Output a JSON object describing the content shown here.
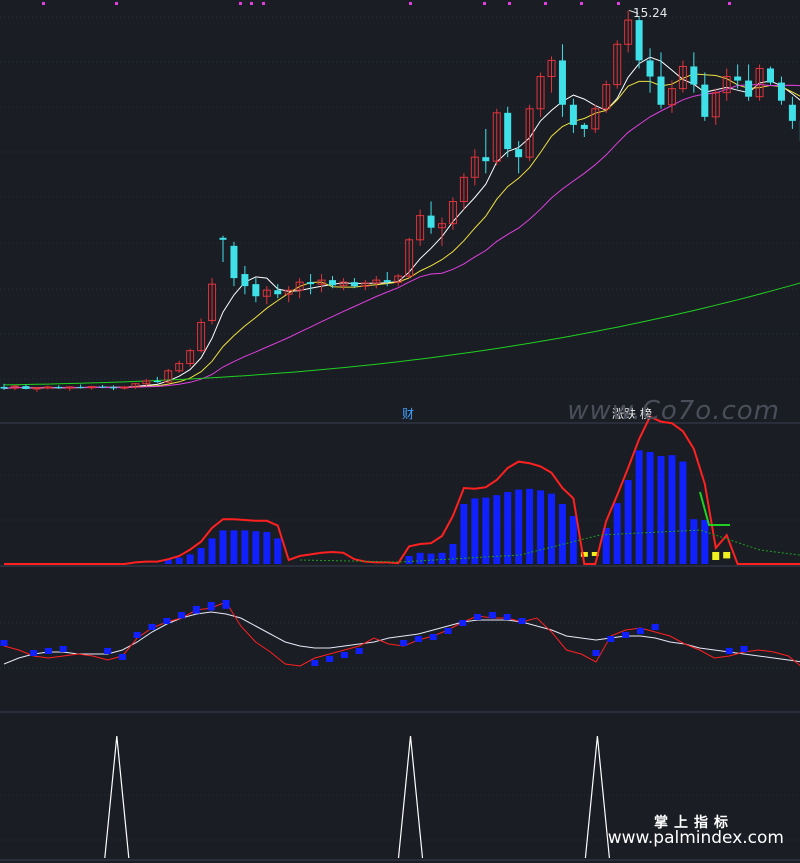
{
  "labels": {
    "price_high": "15.24",
    "tag_cai": "财",
    "tag_rank": "涨跌 榜",
    "watermark_top": "www.Co7o.com",
    "watermark_brand": "掌上指标",
    "watermark_url": "www.palmindex.com"
  },
  "colors": {
    "background": "#1a1d24",
    "up": "#e0343a",
    "down": "#40e0e8",
    "ma5": "#ffffff",
    "ma10": "#f0e040",
    "ma20": "#e040e0",
    "ma60": "#20d020",
    "histogram": "#1020ff",
    "highlight": "#f0f020",
    "envelope": "#ff2020",
    "signal": "#ffffff"
  },
  "chart_data": [
    {
      "type": "candlestick",
      "y_high_label": 15.24,
      "candles": [
        {
          "o": 5.9,
          "h": 5.98,
          "l": 5.83,
          "c": 5.86
        },
        {
          "o": 5.87,
          "h": 5.95,
          "l": 5.82,
          "c": 5.92
        },
        {
          "o": 5.92,
          "h": 5.96,
          "l": 5.84,
          "c": 5.85
        },
        {
          "o": 5.85,
          "h": 5.9,
          "l": 5.78,
          "c": 5.88
        },
        {
          "o": 5.88,
          "h": 5.93,
          "l": 5.84,
          "c": 5.9
        },
        {
          "o": 5.9,
          "h": 5.94,
          "l": 5.85,
          "c": 5.87
        },
        {
          "o": 5.87,
          "h": 5.92,
          "l": 5.8,
          "c": 5.9
        },
        {
          "o": 5.9,
          "h": 5.96,
          "l": 5.86,
          "c": 5.88
        },
        {
          "o": 5.88,
          "h": 5.93,
          "l": 5.83,
          "c": 5.91
        },
        {
          "o": 5.91,
          "h": 5.95,
          "l": 5.87,
          "c": 5.89
        },
        {
          "o": 5.89,
          "h": 5.94,
          "l": 5.82,
          "c": 5.87
        },
        {
          "o": 5.87,
          "h": 5.92,
          "l": 5.83,
          "c": 5.9
        },
        {
          "o": 5.9,
          "h": 6.0,
          "l": 5.85,
          "c": 5.98
        },
        {
          "o": 5.98,
          "h": 6.1,
          "l": 5.92,
          "c": 6.05
        },
        {
          "o": 6.05,
          "h": 6.15,
          "l": 6.0,
          "c": 6.02
        },
        {
          "o": 6.02,
          "h": 6.35,
          "l": 6.0,
          "c": 6.3
        },
        {
          "o": 6.3,
          "h": 6.55,
          "l": 6.25,
          "c": 6.48
        },
        {
          "o": 6.48,
          "h": 6.85,
          "l": 6.4,
          "c": 6.8
        },
        {
          "o": 6.8,
          "h": 7.6,
          "l": 6.75,
          "c": 7.5
        },
        {
          "o": 7.55,
          "h": 8.6,
          "l": 7.45,
          "c": 8.45
        },
        {
          "o": 9.6,
          "h": 9.65,
          "l": 9.0,
          "c": 9.55
        },
        {
          "o": 9.4,
          "h": 9.5,
          "l": 8.4,
          "c": 8.6
        },
        {
          "o": 8.7,
          "h": 8.9,
          "l": 8.2,
          "c": 8.4
        },
        {
          "o": 8.45,
          "h": 8.6,
          "l": 8.0,
          "c": 8.15
        },
        {
          "o": 8.15,
          "h": 8.4,
          "l": 7.95,
          "c": 8.3
        },
        {
          "o": 8.3,
          "h": 8.45,
          "l": 8.1,
          "c": 8.2
        },
        {
          "o": 8.2,
          "h": 8.4,
          "l": 8.0,
          "c": 8.3
        },
        {
          "o": 8.3,
          "h": 8.6,
          "l": 8.1,
          "c": 8.5
        },
        {
          "o": 8.5,
          "h": 8.7,
          "l": 8.2,
          "c": 8.45
        },
        {
          "o": 8.45,
          "h": 8.7,
          "l": 8.25,
          "c": 8.55
        },
        {
          "o": 8.55,
          "h": 8.65,
          "l": 8.35,
          "c": 8.42
        },
        {
          "o": 8.42,
          "h": 8.6,
          "l": 8.3,
          "c": 8.5
        },
        {
          "o": 8.5,
          "h": 8.6,
          "l": 8.35,
          "c": 8.4
        },
        {
          "o": 8.4,
          "h": 8.55,
          "l": 8.3,
          "c": 8.48
        },
        {
          "o": 8.48,
          "h": 8.65,
          "l": 8.35,
          "c": 8.55
        },
        {
          "o": 8.55,
          "h": 8.75,
          "l": 8.4,
          "c": 8.5
        },
        {
          "o": 8.5,
          "h": 8.7,
          "l": 8.4,
          "c": 8.65
        },
        {
          "o": 8.65,
          "h": 9.6,
          "l": 8.6,
          "c": 9.55
        },
        {
          "o": 9.55,
          "h": 10.3,
          "l": 9.4,
          "c": 10.15
        },
        {
          "o": 10.15,
          "h": 10.5,
          "l": 9.7,
          "c": 9.85
        },
        {
          "o": 9.85,
          "h": 10.1,
          "l": 9.4,
          "c": 9.95
        },
        {
          "o": 9.95,
          "h": 10.6,
          "l": 9.8,
          "c": 10.5
        },
        {
          "o": 10.5,
          "h": 11.2,
          "l": 10.3,
          "c": 11.1
        },
        {
          "o": 11.1,
          "h": 11.8,
          "l": 10.9,
          "c": 11.6
        },
        {
          "o": 11.6,
          "h": 12.3,
          "l": 11.2,
          "c": 11.5
        },
        {
          "o": 11.5,
          "h": 12.8,
          "l": 11.4,
          "c": 12.7
        },
        {
          "o": 12.7,
          "h": 12.85,
          "l": 11.6,
          "c": 11.8
        },
        {
          "o": 11.8,
          "h": 12.0,
          "l": 11.2,
          "c": 11.6
        },
        {
          "o": 11.6,
          "h": 12.9,
          "l": 11.5,
          "c": 12.8
        },
        {
          "o": 12.8,
          "h": 13.7,
          "l": 12.6,
          "c": 13.6
        },
        {
          "o": 13.6,
          "h": 14.1,
          "l": 13.2,
          "c": 14.0
        },
        {
          "o": 14.0,
          "h": 14.4,
          "l": 12.6,
          "c": 12.9
        },
        {
          "o": 12.9,
          "h": 13.05,
          "l": 12.2,
          "c": 12.4
        },
        {
          "o": 12.4,
          "h": 12.45,
          "l": 12.1,
          "c": 12.3
        },
        {
          "o": 12.3,
          "h": 12.9,
          "l": 12.2,
          "c": 12.8
        },
        {
          "o": 12.8,
          "h": 13.5,
          "l": 12.7,
          "c": 13.4
        },
        {
          "o": 13.4,
          "h": 14.5,
          "l": 13.3,
          "c": 14.4
        },
        {
          "o": 14.4,
          "h": 15.24,
          "l": 14.2,
          "c": 15.0
        },
        {
          "o": 15.0,
          "h": 15.1,
          "l": 13.8,
          "c": 14.0
        },
        {
          "o": 14.0,
          "h": 14.3,
          "l": 13.2,
          "c": 13.6
        },
        {
          "o": 13.6,
          "h": 14.2,
          "l": 12.8,
          "c": 12.9
        },
        {
          "o": 12.9,
          "h": 13.5,
          "l": 12.7,
          "c": 13.3
        },
        {
          "o": 13.3,
          "h": 14.0,
          "l": 13.2,
          "c": 13.85
        },
        {
          "o": 13.85,
          "h": 14.2,
          "l": 13.2,
          "c": 13.4
        },
        {
          "o": 13.4,
          "h": 13.7,
          "l": 12.5,
          "c": 12.6
        },
        {
          "o": 12.6,
          "h": 13.3,
          "l": 12.4,
          "c": 13.2
        },
        {
          "o": 13.2,
          "h": 13.8,
          "l": 13.0,
          "c": 13.6
        },
        {
          "o": 13.6,
          "h": 13.9,
          "l": 13.3,
          "c": 13.5
        },
        {
          "o": 13.5,
          "h": 13.9,
          "l": 13.0,
          "c": 13.1
        },
        {
          "o": 13.1,
          "h": 13.9,
          "l": 13.0,
          "c": 13.8
        },
        {
          "o": 13.8,
          "h": 13.85,
          "l": 13.4,
          "c": 13.45
        },
        {
          "o": 13.45,
          "h": 13.6,
          "l": 12.9,
          "c": 13.0
        },
        {
          "o": 12.9,
          "h": 13.1,
          "l": 12.3,
          "c": 12.5
        },
        {
          "o": 12.5,
          "h": 12.6,
          "l": 11.9,
          "c": 12.0
        }
      ],
      "moving_averages": [
        {
          "period": 5,
          "color": "ma5"
        },
        {
          "period": 10,
          "color": "ma10"
        },
        {
          "period": 20,
          "color": "ma20"
        },
        {
          "period": 60,
          "color": "ma60"
        }
      ]
    },
    {
      "type": "bar",
      "histogram": [
        0,
        0,
        0,
        0,
        0,
        0,
        0,
        0,
        0,
        0,
        0,
        0,
        0,
        0,
        0,
        0.6,
        0.8,
        1.2,
        2.0,
        3.2,
        4.2,
        4.2,
        4.2,
        4.1,
        4.0,
        3.2,
        0,
        0,
        0,
        0,
        0,
        0,
        0,
        0,
        0,
        0,
        0,
        1.0,
        1.4,
        1.3,
        1.4,
        2.5,
        7.5,
        8.2,
        8.3,
        8.6,
        9.0,
        9.3,
        9.4,
        9.2,
        8.8,
        7.5,
        6.0,
        -0.6,
        -0.5,
        4.5,
        7.6,
        10.5,
        14.2,
        14.0,
        13.5,
        13.6,
        12.8,
        5.6,
        5.5,
        -1.0,
        -0.8,
        0,
        0,
        0,
        0,
        0,
        0,
        0
      ],
      "envelope": [
        0,
        0,
        0,
        0,
        0,
        0,
        0,
        0,
        0,
        0,
        0,
        0,
        0.2,
        0.3,
        0.3,
        0.6,
        1.0,
        1.8,
        2.8,
        4.5,
        5.6,
        5.6,
        5.5,
        5.4,
        5.4,
        4.8,
        0.5,
        1.0,
        1.2,
        1.4,
        1.5,
        1.4,
        0.6,
        0.3,
        0.2,
        0.2,
        0.1,
        2.2,
        2.5,
        2.6,
        3.5,
        6.0,
        9.5,
        9.4,
        9.6,
        10.5,
        12.0,
        12.8,
        12.6,
        12.2,
        11.4,
        9.5,
        8.2,
        0,
        0,
        5.4,
        8.6,
        12.0,
        15.6,
        18.4,
        17.8,
        17.6,
        16.6,
        14.4,
        10.0,
        2.0,
        3.6,
        -1.2,
        0,
        0,
        0,
        0,
        0,
        0
      ],
      "highlight_bars": [
        53,
        54,
        65,
        66,
        67
      ]
    },
    {
      "type": "line",
      "bars": [
        0.2,
        0,
        -0.3,
        -0.2,
        -0.1,
        0,
        0,
        -0.2,
        -0.5,
        0.6,
        1.0,
        1.3,
        1.6,
        1.9,
        2.1,
        2.2,
        0,
        0,
        0,
        0,
        0,
        -0.8,
        -0.6,
        -0.4,
        -0.2,
        0,
        0,
        0.2,
        0.4,
        0.5,
        0.8,
        1.2,
        1.5,
        1.6,
        1.5,
        1.3,
        0,
        0,
        0,
        0,
        -0.3,
        0.4,
        0.6,
        0.8,
        1.0,
        0,
        0,
        0,
        0,
        -0.2,
        -0.1,
        0,
        0
      ],
      "fast": [
        0.1,
        -0.1,
        -0.4,
        -0.5,
        -0.4,
        -0.3,
        -0.4,
        -0.6,
        -0.4,
        0.5,
        1.0,
        1.3,
        1.5,
        1.9,
        2.0,
        2.3,
        1.1,
        0.3,
        -0.2,
        -0.8,
        -0.9,
        -0.5,
        -0.3,
        -0.1,
        0.1,
        0.5,
        0.2,
        0.1,
        0.4,
        0.6,
        0.9,
        1.3,
        1.6,
        1.5,
        1.5,
        1.3,
        1.5,
        0.8,
        -0.1,
        -0.3,
        -0.7,
        0.6,
        0.9,
        1.0,
        0.8,
        0.6,
        0.2,
        -0.1,
        -0.5,
        -0.4,
        -0.2,
        -0.1,
        -0.2,
        -0.4,
        -1.0
      ],
      "slow": [
        -0.8,
        -0.5,
        -0.3,
        -0.2,
        -0.2,
        -0.3,
        -0.3,
        -0.3,
        -0.1,
        0.3,
        0.8,
        1.2,
        1.5,
        1.7,
        1.8,
        1.7,
        1.5,
        1.1,
        0.7,
        0.3,
        0.1,
        0.0,
        0.0,
        0.1,
        0.2,
        0.3,
        0.5,
        0.6,
        0.7,
        0.9,
        1.1,
        1.3,
        1.4,
        1.4,
        1.4,
        1.3,
        1.1,
        0.9,
        0.6,
        0.5,
        0.4,
        0.5,
        0.6,
        0.6,
        0.5,
        0.3,
        0.2,
        0.0,
        -0.1,
        -0.2,
        -0.3,
        -0.4,
        -0.5,
        -0.6,
        -0.7
      ]
    },
    {
      "type": "line",
      "spikes": [
        {
          "index": 8
        },
        {
          "index": 30
        },
        {
          "index": 44
        }
      ],
      "series_length": 60
    }
  ]
}
